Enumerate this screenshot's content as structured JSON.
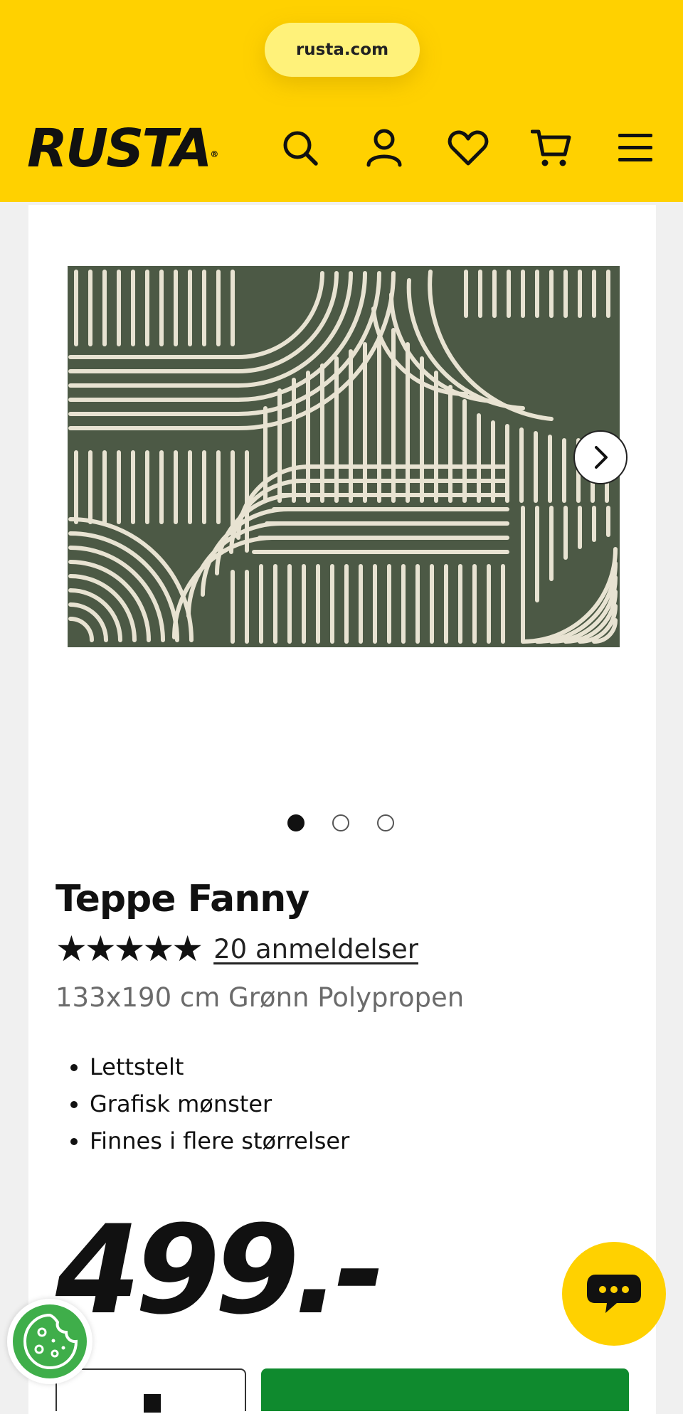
{
  "browser": {
    "url": "rusta.com"
  },
  "header": {
    "logo_text": "RUSTA",
    "logo_mark": "®",
    "icons": [
      "search-icon",
      "account-icon",
      "wishlist-heart-icon",
      "cart-icon",
      "menu-icon"
    ]
  },
  "product": {
    "title": "Teppe Fanny",
    "stars": "★★★★★",
    "rating": 5,
    "reviews_label": "20 anmeldelser",
    "subtitle": "133x190 cm Grønn Polypropen",
    "features": [
      "Lettstelt",
      "Grafisk mønster",
      "Finnes i flere størrelser"
    ],
    "price": "499.-",
    "gallery": {
      "count": 3,
      "active": 0
    }
  },
  "colors": {
    "brand_yellow": "#ffd100",
    "rug_green": "#4c5945",
    "rug_stripe": "#e8e3d2",
    "buy_green": "#0f8a2e",
    "cookie_green": "#3fae4a"
  }
}
